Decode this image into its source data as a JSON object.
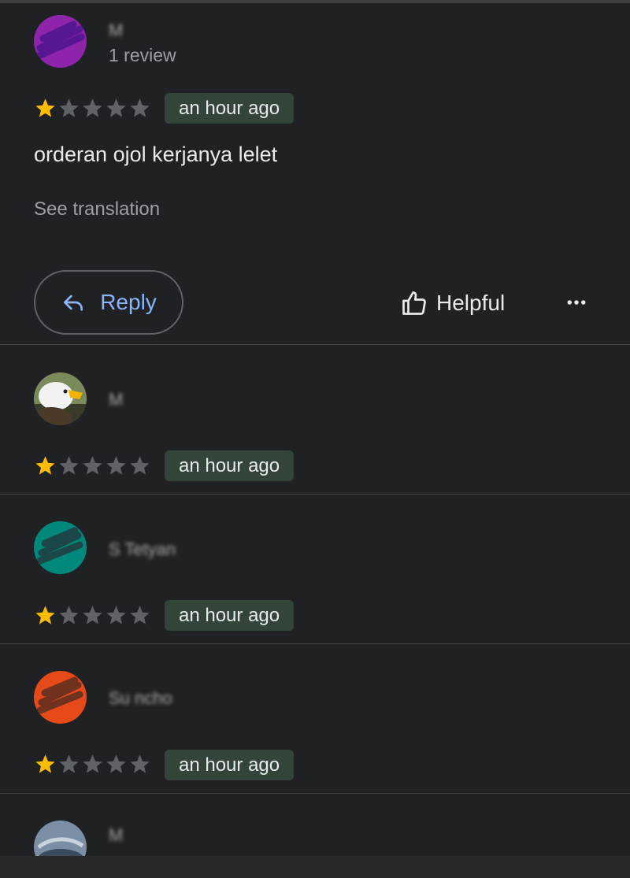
{
  "colors": {
    "background": "#202124",
    "star_filled": "#fbbc04",
    "star_empty": "#5f6368",
    "badge_bg": "#334539",
    "link": "#8ab4f8"
  },
  "reviews": [
    {
      "name": "M",
      "review_count": "1 review",
      "rating": 1,
      "time": "an hour ago",
      "text": "orderan ojol kerjanya lelet",
      "see_translation": "See translation",
      "reply_label": "Reply",
      "helpful_label": "Helpful",
      "avatar_color": "#8e24aa"
    },
    {
      "name": "M",
      "rating": 1,
      "time": "an hour ago",
      "avatar": "eagle-photo"
    },
    {
      "name": "S Tetyan",
      "rating": 1,
      "time": "an hour ago",
      "avatar_color": "#00897b"
    },
    {
      "name": "Su ncho",
      "rating": 1,
      "time": "an hour ago",
      "avatar_color": "#e64a19"
    },
    {
      "name": "M",
      "avatar": "photo"
    }
  ]
}
